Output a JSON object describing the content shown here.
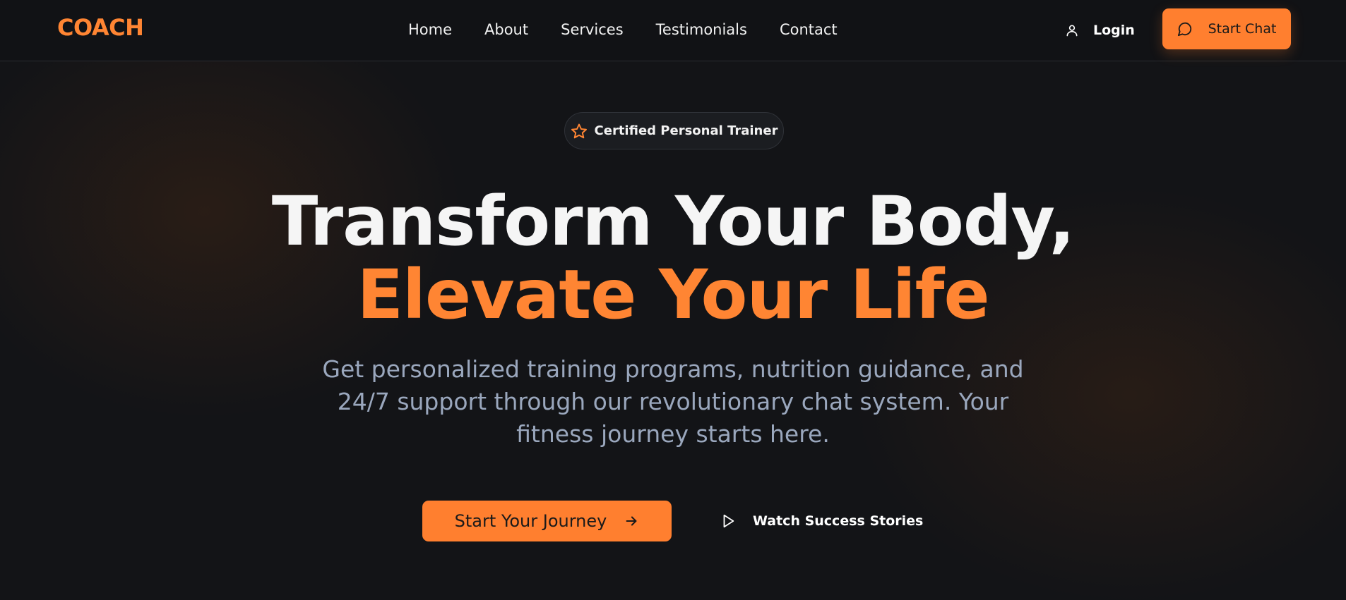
{
  "brand": {
    "logo_text": "COACH",
    "accent_color": "#ff8533"
  },
  "nav": {
    "links": [
      {
        "label": "Home"
      },
      {
        "label": "About"
      },
      {
        "label": "Services"
      },
      {
        "label": "Testimonials"
      },
      {
        "label": "Contact"
      }
    ],
    "login_label": "Login",
    "login_icon": "user-icon",
    "start_chat_label": "Start Chat",
    "start_chat_icon": "chat-bubble-icon"
  },
  "hero": {
    "badge_label": "Certified Personal Trainer",
    "badge_icon": "star-icon",
    "headline_line1": "Transform Your Body,",
    "headline_line2": "Elevate Your Life",
    "subtitle": "Get personalized training programs, nutrition guidance, and 24/7 support through our revolutionary chat system. Your fitness journey starts here.",
    "primary_cta_label": "Start Your Journey",
    "primary_cta_icon": "arrow-right-icon",
    "secondary_cta_label": "Watch Success Stories",
    "secondary_cta_icon": "play-icon"
  }
}
